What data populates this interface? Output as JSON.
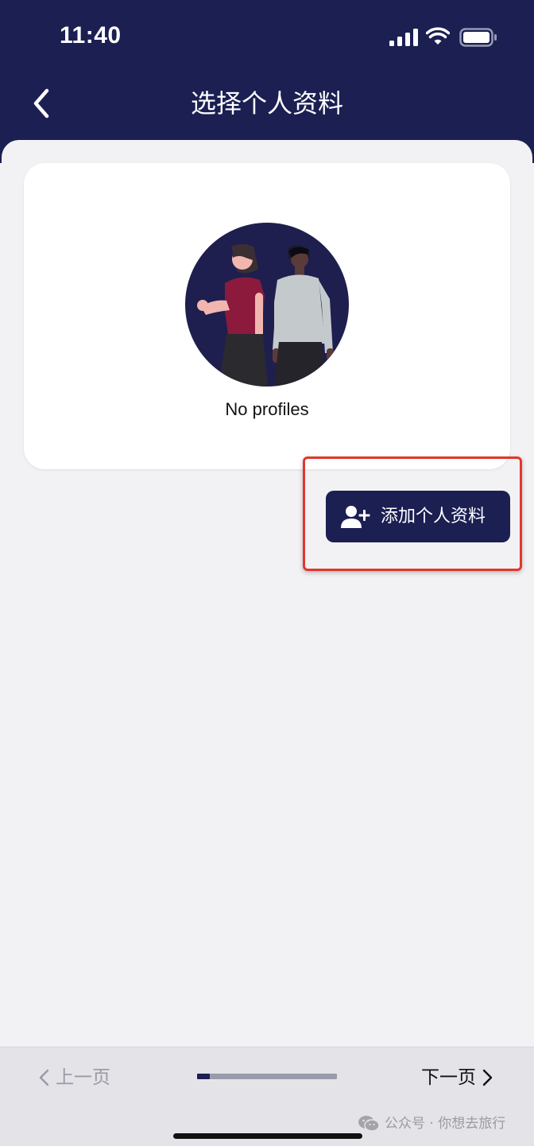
{
  "status_bar": {
    "time": "11:40",
    "icons": [
      "signal-icon",
      "wifi-icon",
      "battery-icon"
    ]
  },
  "header": {
    "title": "选择个人资料",
    "back_icon": "chevron-left-icon"
  },
  "empty_state": {
    "illustration": "two-people-illustration",
    "message": "No profiles"
  },
  "actions": {
    "add_profile_label": "添加个人资料",
    "add_profile_icon": "user-plus-icon"
  },
  "footer": {
    "prev_label": "上一页",
    "next_label": "下一页",
    "progress_fraction": 0.09
  },
  "watermark": {
    "text": "公众号 · 你想去旅行"
  },
  "colors": {
    "primary": "#1b1f52",
    "background": "#f2f1f4",
    "highlight": "#e0372c",
    "disabled_text": "#9a9aa6"
  }
}
